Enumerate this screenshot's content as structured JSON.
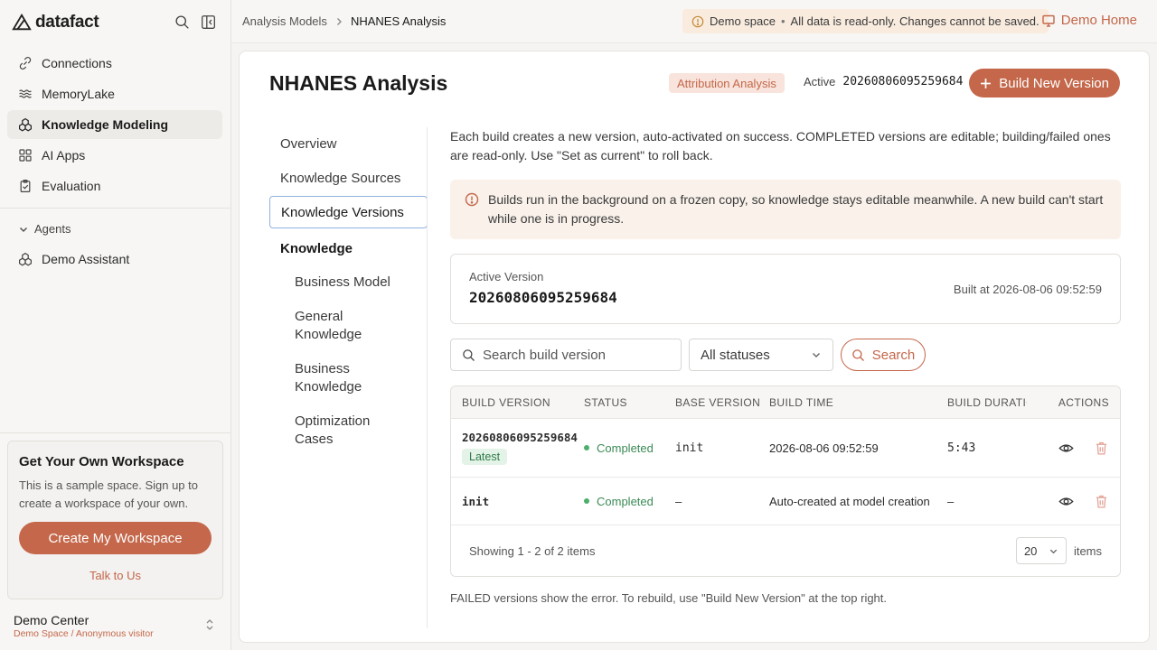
{
  "app": {
    "brand": "datafact"
  },
  "sidebar": {
    "items": [
      {
        "label": "Connections",
        "icon": "link-icon"
      },
      {
        "label": "MemoryLake",
        "icon": "waves-icon"
      },
      {
        "label": "Knowledge Modeling",
        "icon": "cubes-icon",
        "active": true
      },
      {
        "label": "AI Apps",
        "icon": "grid-icon"
      },
      {
        "label": "Evaluation",
        "icon": "clipboard-icon"
      }
    ],
    "agents_header": "Agents",
    "agents": [
      {
        "label": "Demo Assistant"
      }
    ],
    "promo": {
      "title": "Get Your Own Workspace",
      "text": "This is a sample space. Sign up to create a workspace of your own.",
      "button": "Create My Workspace",
      "link": "Talk to Us"
    },
    "user": {
      "name": "Demo Center",
      "sub": "Demo Space / Anonymous visitor"
    }
  },
  "topbar": {
    "breadcrumbs": [
      "Analysis Models",
      "NHANES Analysis"
    ],
    "banner_label": "Demo space",
    "banner_text": "All data is read-only. Changes cannot be saved.",
    "demo_home": "Demo Home"
  },
  "page": {
    "title": "NHANES Analysis",
    "type_tag": "Attribution Analysis",
    "active_label": "Active",
    "active_version": "20260806095259684",
    "build_button": "Build New Version"
  },
  "subnav": {
    "items": [
      "Overview",
      "Knowledge Sources",
      "Knowledge Versions"
    ],
    "section": "Knowledge",
    "children": [
      "Business Model",
      "General Knowledge",
      "Business Knowledge",
      "Optimization Cases"
    ]
  },
  "content": {
    "intro": "Each build creates a new version, auto-activated on success. COMPLETED versions are editable; building/failed ones are read-only. Use \"Set as current\" to roll back.",
    "notice": "Builds run in the background on a frozen copy, so knowledge stays editable meanwhile. A new build can't start while one is in progress.",
    "active_card": {
      "label": "Active Version",
      "value": "20260806095259684",
      "built": "Built at 2026-08-06 09:52:59"
    },
    "search_placeholder": "Search build version",
    "status_filter": "All statuses",
    "search_button": "Search",
    "table": {
      "headers": [
        "BUILD VERSION",
        "STATUS",
        "BASE VERSION",
        "BUILD TIME",
        "BUILD DURATION",
        "ACTIONS"
      ],
      "rows": [
        {
          "version": "20260806095259684",
          "badge": "Latest",
          "status": "Completed",
          "base": "init",
          "time": "2026-08-06 09:52:59",
          "duration": "5:43"
        },
        {
          "version": "init",
          "badge": "",
          "status": "Completed",
          "base": "–",
          "time": "Auto-created at model creation",
          "duration": "–"
        }
      ]
    },
    "pagination": {
      "summary": "Showing 1 - 2 of 2 items",
      "page_size": "20",
      "unit": "items"
    },
    "footnote": "FAILED versions show the error. To rebuild, use \"Build New Version\" at the top right."
  },
  "colors": {
    "accent": "#c4674a",
    "success": "#4caf6a",
    "focus": "#8fb3de"
  }
}
